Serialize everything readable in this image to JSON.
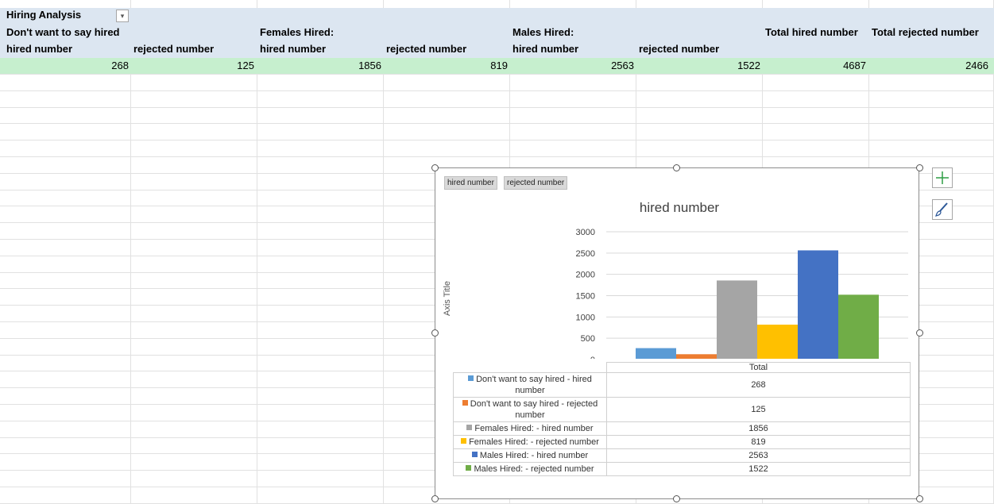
{
  "sheet": {
    "title": "Hiring Analysis",
    "filter_icon": "dropdown-filter-icon",
    "group_headers": [
      "Don't want to say hired",
      "Females Hired:",
      "Males Hired:"
    ],
    "column_headers": [
      "hired number",
      "rejected number",
      "hired number",
      "rejected number",
      "hired number",
      "rejected number",
      "Total hired number",
      "Total rejected number"
    ],
    "values": [
      "268",
      "125",
      "1856",
      "819",
      "2563",
      "1522",
      "4687",
      "2466"
    ],
    "colors": {
      "header_band": "#dce6f1",
      "value_band": "#c6efce"
    }
  },
  "chart": {
    "field_buttons": [
      "hired number",
      "rejected number"
    ],
    "axis_title": "Axis Title",
    "side_buttons": [
      "chart-elements-plus-icon",
      "chart-styles-brush-icon"
    ]
  },
  "chart_data": {
    "type": "bar",
    "title": "hired number",
    "categories": [
      "Total"
    ],
    "ylabel": "Axis Title",
    "ylim": [
      0,
      3000
    ],
    "yticks": [
      0,
      500,
      1000,
      1500,
      2000,
      2500,
      3000
    ],
    "grid": true,
    "series": [
      {
        "name": "Don't want to say hired - hired number",
        "values": [
          268
        ],
        "color": "#5b9bd5"
      },
      {
        "name": "Don't want to say hired - rejected number",
        "values": [
          125
        ],
        "color": "#ed7d31"
      },
      {
        "name": "Females Hired: - hired number",
        "values": [
          1856
        ],
        "color": "#a5a5a5"
      },
      {
        "name": "Females Hired: - rejected number",
        "values": [
          819
        ],
        "color": "#ffc000"
      },
      {
        "name": "Males Hired: - hired number",
        "values": [
          2563
        ],
        "color": "#4472c4"
      },
      {
        "name": "Males Hired: - rejected number",
        "values": [
          1522
        ],
        "color": "#70ad47"
      }
    ]
  }
}
